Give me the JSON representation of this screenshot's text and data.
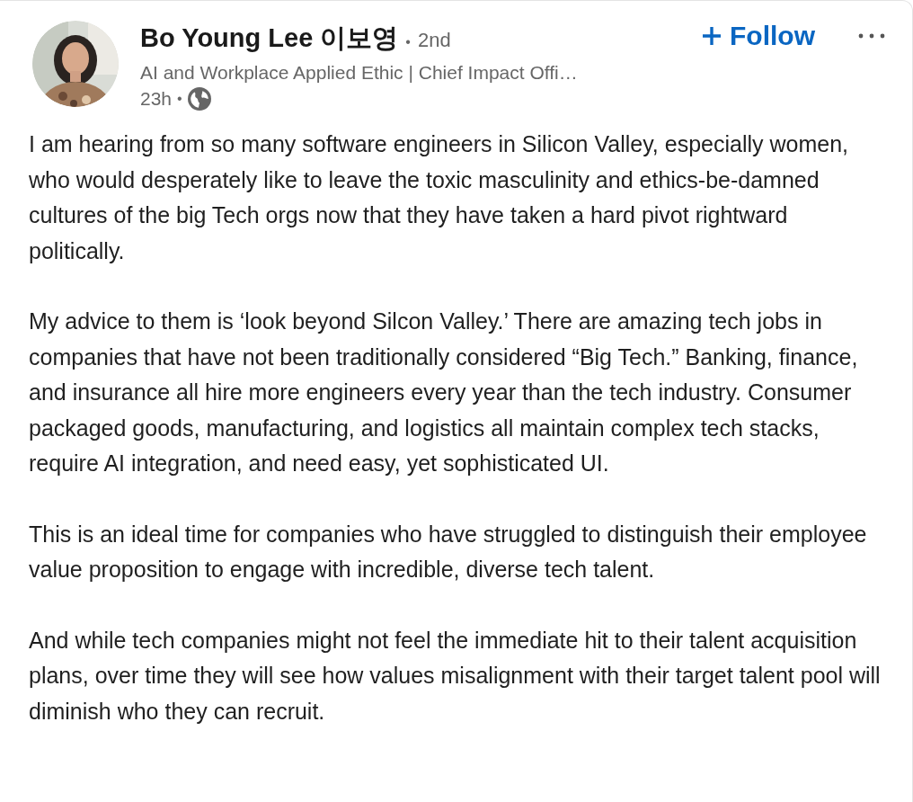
{
  "post": {
    "author": {
      "name": "Bo Young Lee 이보영",
      "degree": "2nd",
      "headline": "AI and Workplace Applied Ethic | Chief Impact Offi…",
      "time": "23h",
      "separator": "•"
    },
    "follow_button": {
      "label": "Follow"
    },
    "paragraphs": [
      "I am hearing from so many software engineers in Silicon Valley, especially women, who would desperately like to leave the toxic masculinity and ethics-be-damned cultures of the big Tech orgs now that they have taken a hard pivot rightward politically.",
      "My advice to them is ‘look beyond Silcon Valley.’ There are amazing tech jobs in companies that have not been traditionally considered “Big Tech.” Banking, finance, and insurance all hire more engineers every year than the tech industry. Consumer packaged goods, manufacturing, and logistics all maintain complex tech stacks, require AI integration, and need easy, yet sophisticated UI.",
      "This is an ideal time for companies who have struggled to distinguish their employee value proposition to engage with incredible, diverse tech talent.",
      "And while tech companies might not feel the immediate hit to their talent acquisition plans, over time they will see how values misalignment with their target talent pool will diminish who they can recruit."
    ]
  }
}
